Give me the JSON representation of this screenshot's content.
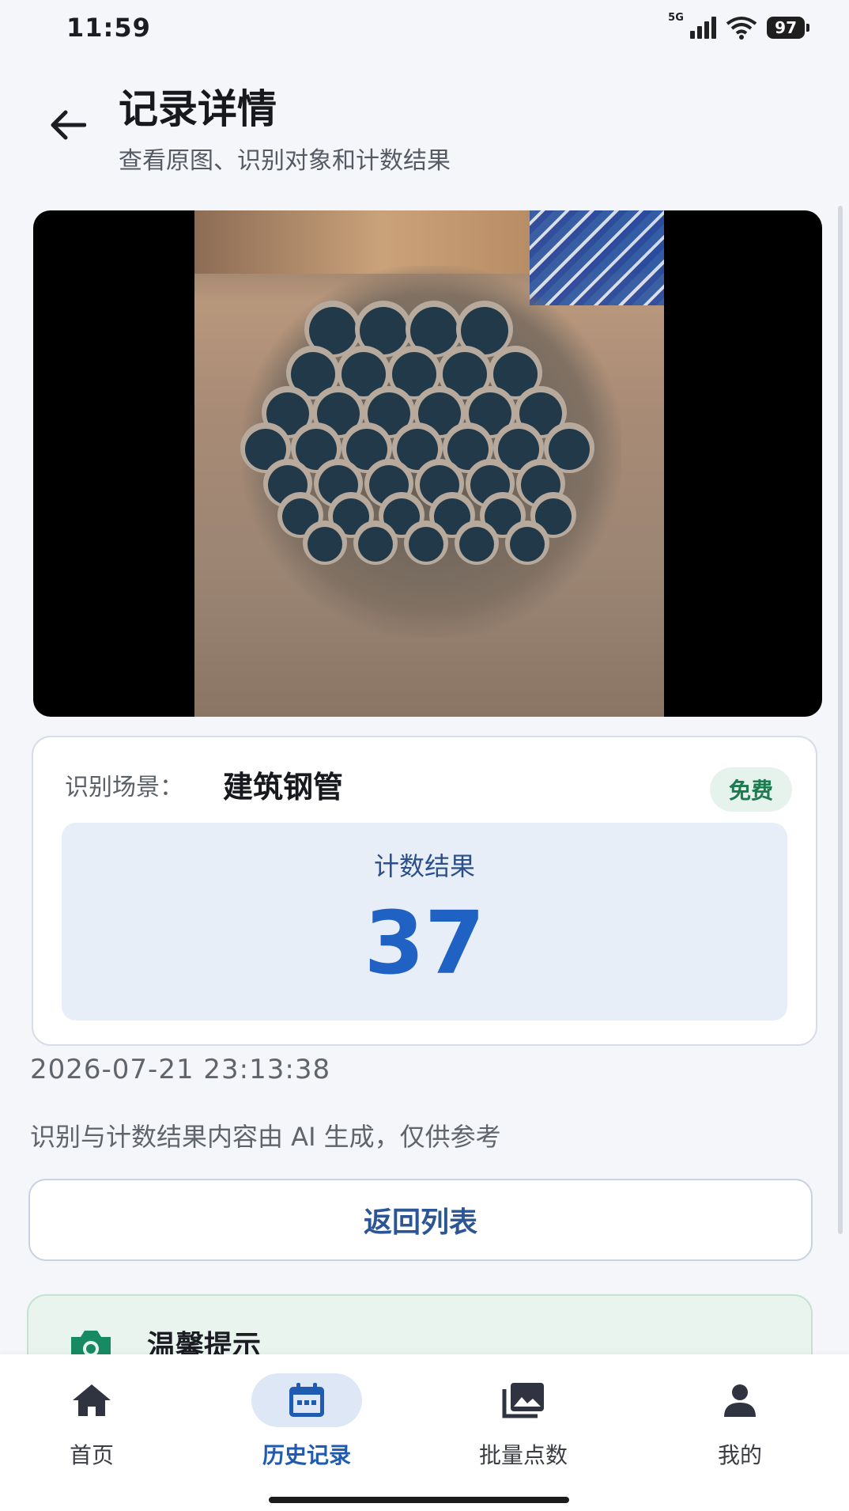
{
  "status_bar": {
    "time": "11:59",
    "network": "5G",
    "battery": "97"
  },
  "header": {
    "title": "记录详情",
    "subtitle": "查看原图、识别对象和计数结果"
  },
  "result": {
    "scene_label": "识别场景：",
    "scene_value": "建筑钢管",
    "badge": "免费",
    "count_label": "计数结果",
    "count_value": "37"
  },
  "timestamp": "2026-07-21 23:13:38",
  "disclaimer": "识别与计数结果内容由 AI 生成，仅供参考",
  "back_list_button": "返回列表",
  "tip": {
    "title": "温馨提示"
  },
  "bottom_nav": [
    {
      "label": "首页",
      "icon": "home-icon"
    },
    {
      "label": "历史记录",
      "icon": "calendar-icon",
      "active": true
    },
    {
      "label": "批量点数",
      "icon": "gallery-icon"
    },
    {
      "label": "我的",
      "icon": "person-icon"
    }
  ],
  "colors": {
    "accent": "#1f62c4",
    "nav_active": "#1f5bb0",
    "badge_green": "#1d7b50"
  }
}
